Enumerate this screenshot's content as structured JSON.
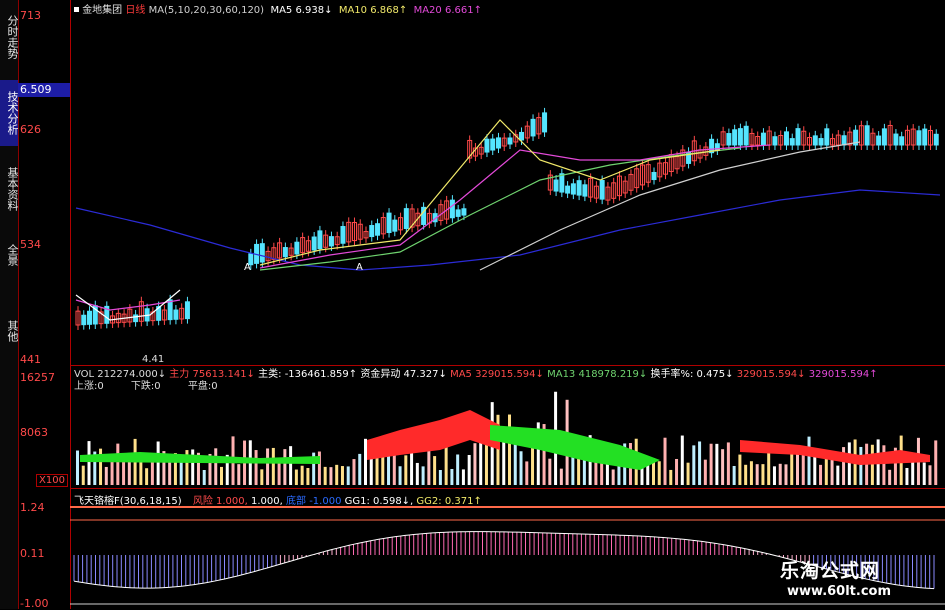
{
  "sidebar": {
    "tabs": [
      {
        "label": "分时走势",
        "active": false
      },
      {
        "label": "技术分析",
        "active": true
      },
      {
        "label": "基本资料",
        "active": false
      },
      {
        "label": "全景",
        "active": false
      },
      {
        "label": "其他",
        "active": false
      }
    ]
  },
  "axis": {
    "price_top": "713",
    "price_mid1": "626",
    "price_mid2": "534",
    "price_low": "441",
    "current_price": "6.509",
    "vol_top": "16257",
    "vol_mid": "8063",
    "vol_unit": "X100",
    "osc_top": "1.24",
    "osc_mid": "0.11",
    "osc_low": "-1.00"
  },
  "header": {
    "name": "金地集团",
    "period": "日线",
    "ma_def": "MA(5,10,20,30,60,120)",
    "ma5": "MA5  6.938↓",
    "ma10": "MA10  6.868↑",
    "ma20": "MA20  6.661↑"
  },
  "price_labels": {
    "low_marker": "4.41",
    "a_marker1": "A",
    "a_marker2": "A"
  },
  "volume_panel": {
    "vol": "VOL 212274.000↓",
    "zhuli": "主力",
    "num1": "75613.141↓",
    "zhulei": "主类:",
    "num2": "-136461.859↑",
    "zijin": "资金异动",
    "num3": "47.327↓",
    "ma5": "MA5  329015.594↓",
    "ma13": "MA13  418978.219↓",
    "huanshou": "换手率%: 0.475↓",
    "num4": "329015.594↓",
    "num5": "329015.594↑",
    "up": "上涨:0",
    "down": "下跌:0",
    "flat": "平盘:0"
  },
  "osc_panel": {
    "name": "飞天铬榕F(30,6,18,15)",
    "feng": "风险",
    "v1": "1.000,",
    "v2": "1.000,",
    "di": "底部",
    "v3": "-1.000",
    "gg1": "GG1: 0.598↓,",
    "gg2": "GG2: 0.371↑"
  },
  "watermark": {
    "title": "乐淘公式网",
    "url": "www.60lt.com"
  },
  "colors": {
    "up": "#ff4a4a",
    "down": "#55e5ff",
    "grid": "#b00000",
    "ma5": "#ffffff",
    "ma10": "#f1e96a",
    "ma20": "#e34ad9",
    "ma60": "#6fd36f",
    "ma120": "#2b2bd6"
  }
}
